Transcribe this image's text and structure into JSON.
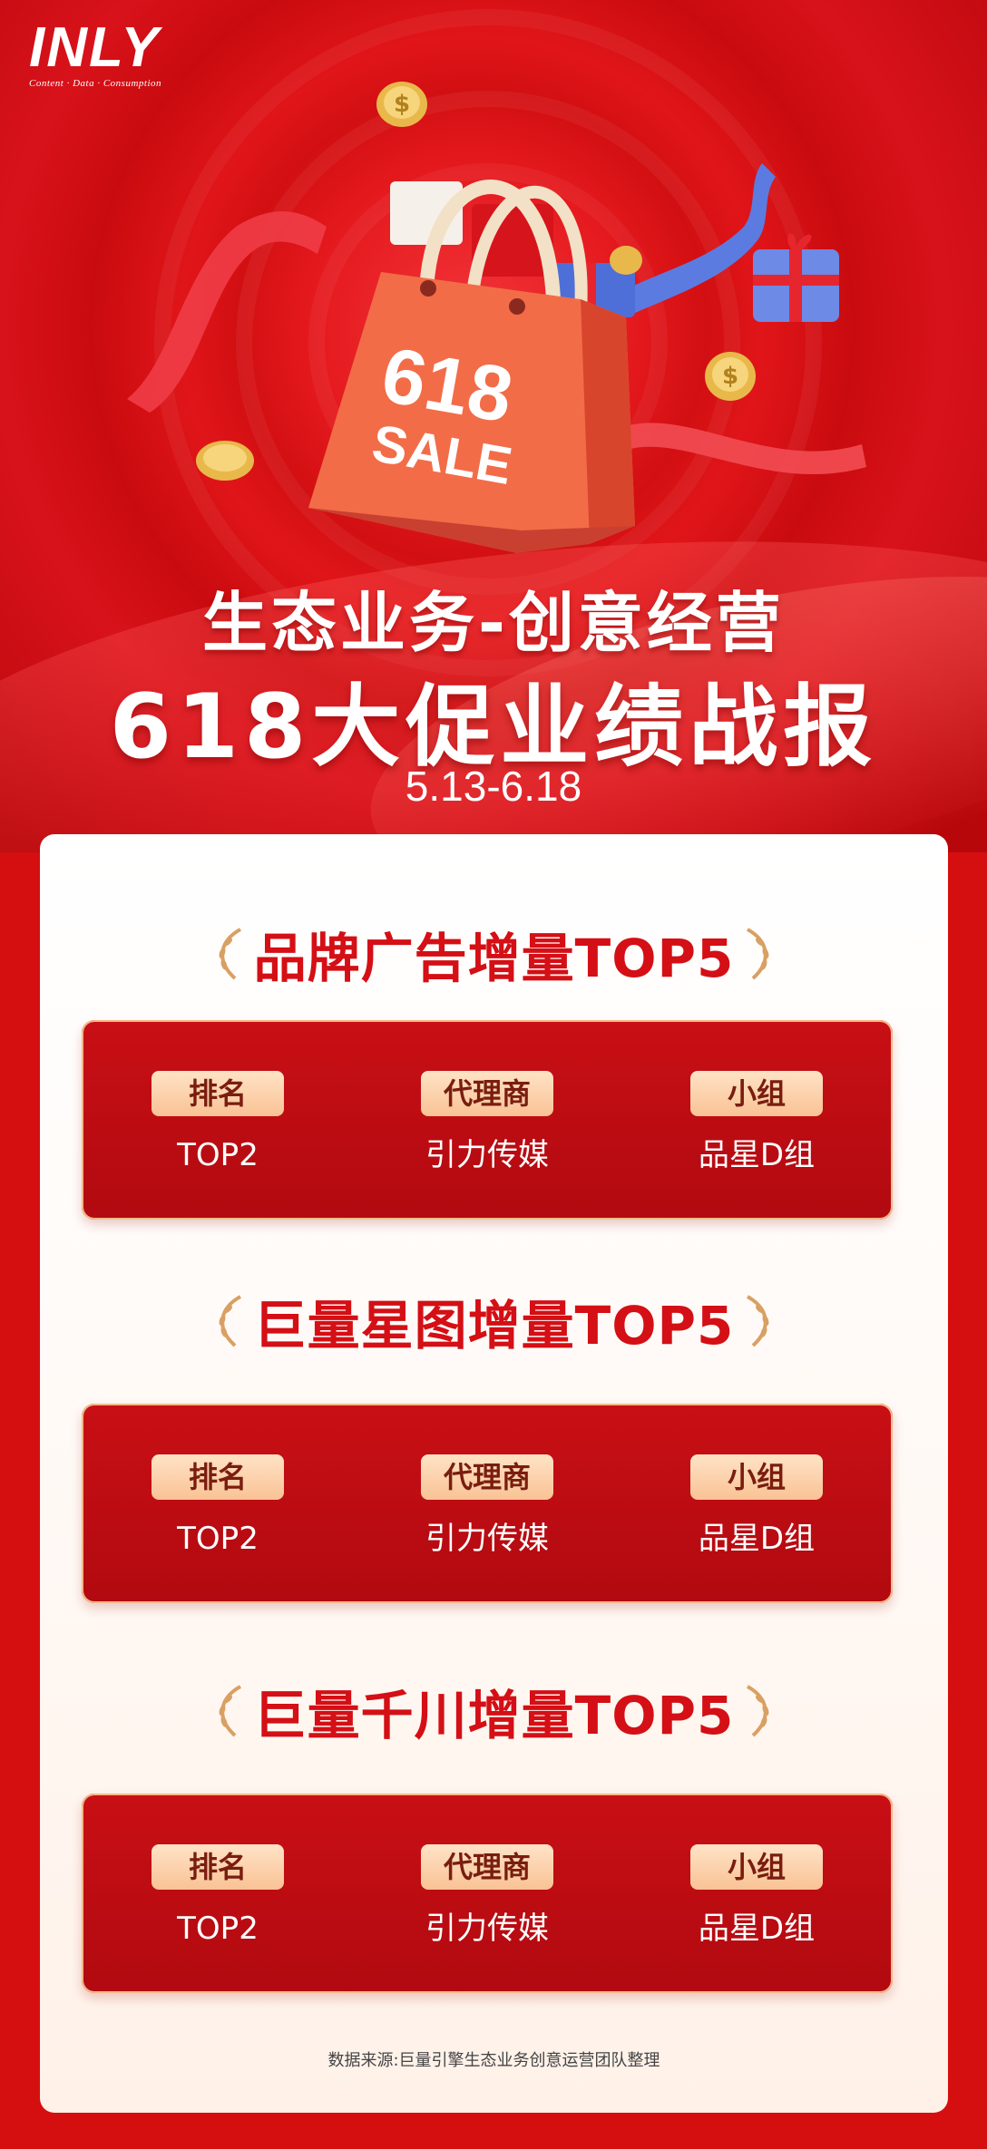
{
  "brand": {
    "name": "INLY",
    "tagline": "Content · Data · Consumption"
  },
  "hero": {
    "bag_text_line1": "618",
    "bag_text_line2": "SALE",
    "title_line1": "生态业务-创意经营",
    "title_line2": "618大促业绩战报",
    "date_range": "5.13-6.18"
  },
  "colors": {
    "primary_red": "#d50f10",
    "chip_bg": "#fbd4b0",
    "title_red": "#d40f15"
  },
  "sections": [
    {
      "title": "品牌广告增量TOP5",
      "headers": {
        "rank": "排名",
        "agency": "代理商",
        "group": "小组"
      },
      "row": {
        "rank": "TOP2",
        "agency": "引力传媒",
        "group": "品星D组"
      }
    },
    {
      "title": "巨量星图增量TOP5",
      "headers": {
        "rank": "排名",
        "agency": "代理商",
        "group": "小组"
      },
      "row": {
        "rank": "TOP2",
        "agency": "引力传媒",
        "group": "品星D组"
      }
    },
    {
      "title": "巨量千川增量TOP5",
      "headers": {
        "rank": "排名",
        "agency": "代理商",
        "group": "小组"
      },
      "row": {
        "rank": "TOP2",
        "agency": "引力传媒",
        "group": "品星D组"
      }
    }
  ],
  "footnote": "数据来源:巨量引擎生态业务创意运营团队整理"
}
